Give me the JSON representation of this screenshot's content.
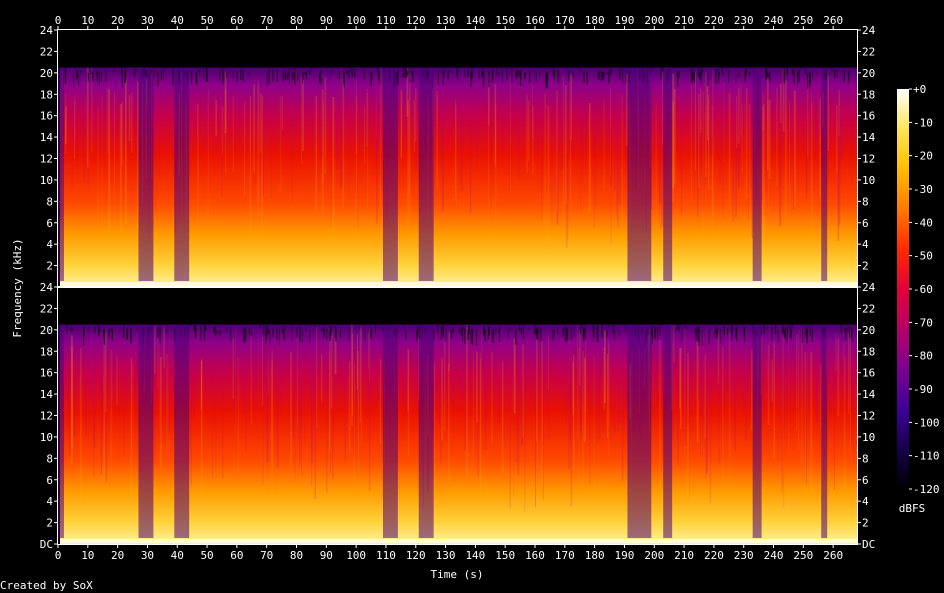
{
  "chart_data": {
    "type": "heatmap",
    "subtype": "spectrogram",
    "xlabel": "Time (s)",
    "ylabel": "Frequency (kHz)",
    "xlim": [
      0,
      268
    ],
    "ylim": [
      0,
      24
    ],
    "x_ticks": [
      0,
      10,
      20,
      30,
      40,
      50,
      60,
      70,
      80,
      90,
      100,
      110,
      120,
      130,
      140,
      150,
      160,
      170,
      180,
      190,
      200,
      210,
      220,
      230,
      240,
      250,
      260
    ],
    "y_ticks": [
      0,
      2,
      4,
      6,
      8,
      10,
      12,
      14,
      16,
      18,
      20,
      22,
      24
    ],
    "y_tick_labels": [
      "DC",
      "2",
      "4",
      "6",
      "8",
      "10",
      "12",
      "14",
      "16",
      "18",
      "20",
      "22",
      "24"
    ],
    "channels": [
      {
        "index": 1,
        "content_cutoff_khz": 20.5
      },
      {
        "index": 2,
        "content_cutoff_khz": 20.5
      }
    ],
    "quiet_passages_s": [
      [
        0,
        2
      ],
      [
        27,
        32
      ],
      [
        39,
        44
      ],
      [
        109,
        114
      ],
      [
        121,
        126
      ],
      [
        191,
        199
      ],
      [
        203,
        206
      ],
      [
        233,
        236
      ],
      [
        256,
        258
      ]
    ],
    "colorbar": {
      "unit": "dBFS",
      "range": [
        -120,
        0
      ],
      "ticks": [
        0,
        -10,
        -20,
        -30,
        -40,
        -50,
        -60,
        -70,
        -80,
        -90,
        -100,
        -110,
        -120
      ],
      "tick_labels": [
        "+0",
        "-10",
        "-20",
        "-30",
        "-40",
        "-50",
        "-60",
        "-70",
        "-80",
        "-90",
        "-100",
        "-110",
        "-120"
      ],
      "colors": [
        "#000000",
        "#16004a",
        "#3f0098",
        "#7b0090",
        "#b5006a",
        "#e4003a",
        "#ff2a00",
        "#ff7a00",
        "#ffbd00",
        "#ffe657",
        "#ffffff"
      ]
    }
  },
  "footer": {
    "credit": "Created by SoX"
  }
}
